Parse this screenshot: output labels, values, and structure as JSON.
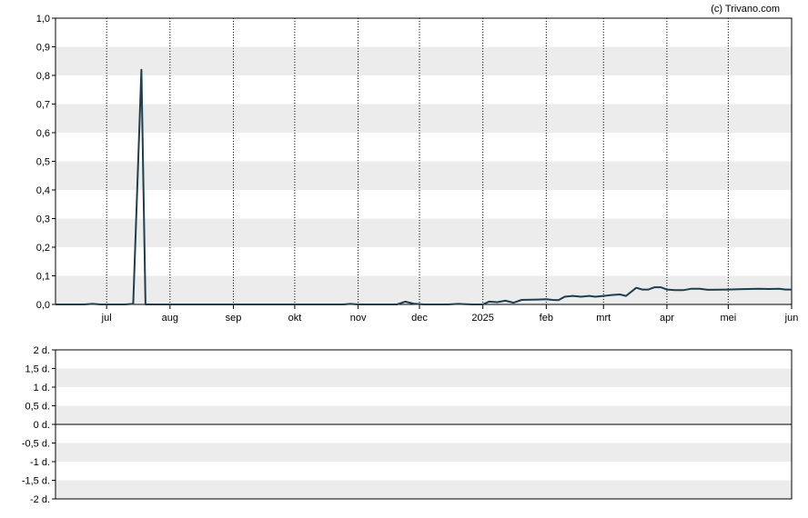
{
  "copyright": "(c) Trivano.com",
  "chart_data": [
    {
      "type": "line",
      "ylim": [
        0,
        1.0
      ],
      "y_ticks": [
        "0,0",
        "0,1",
        "0,2",
        "0,3",
        "0,4",
        "0,5",
        "0,6",
        "0,7",
        "0,8",
        "0,9",
        "1,0"
      ],
      "x_ticks": [
        {
          "label": "jul",
          "date": "2024-07-01"
        },
        {
          "label": "aug",
          "date": "2024-08-01"
        },
        {
          "label": "sep",
          "date": "2024-09-01"
        },
        {
          "label": "okt",
          "date": "2024-10-01"
        },
        {
          "label": "nov",
          "date": "2024-11-01"
        },
        {
          "label": "dec",
          "date": "2024-12-01"
        },
        {
          "label": "2025",
          "date": "2025-01-01"
        },
        {
          "label": "feb",
          "date": "2025-02-01"
        },
        {
          "label": "mrt",
          "date": "2025-03-01"
        },
        {
          "label": "apr",
          "date": "2025-04-01"
        },
        {
          "label": "mei",
          "date": "2025-05-01"
        },
        {
          "label": "jun",
          "date": "2025-06-01"
        }
      ],
      "xlim": [
        "2024-06-06",
        "2025-06-01"
      ],
      "grid": true,
      "line_color": "#1f3e4e",
      "series": [
        {
          "points": [
            [
              "2024-06-06",
              0.0
            ],
            [
              "2024-06-20",
              0.0
            ],
            [
              "2024-06-24",
              0.002
            ],
            [
              "2024-06-28",
              0.0
            ],
            [
              "2024-07-10",
              0.0
            ],
            [
              "2024-07-14",
              0.002
            ],
            [
              "2024-07-18",
              0.82
            ],
            [
              "2024-07-20",
              0.0
            ],
            [
              "2024-08-01",
              0.0
            ],
            [
              "2024-09-01",
              0.0
            ],
            [
              "2024-10-01",
              0.0
            ],
            [
              "2024-10-25",
              0.0
            ],
            [
              "2024-10-28",
              0.002
            ],
            [
              "2024-11-01",
              0.0
            ],
            [
              "2024-11-20",
              0.0
            ],
            [
              "2024-11-24",
              0.01
            ],
            [
              "2024-11-28",
              0.003
            ],
            [
              "2024-12-03",
              0.0
            ],
            [
              "2024-12-15",
              0.0
            ],
            [
              "2024-12-20",
              0.002
            ],
            [
              "2024-12-27",
              0.0
            ],
            [
              "2025-01-01",
              0.0
            ],
            [
              "2025-01-04",
              0.01
            ],
            [
              "2025-01-08",
              0.008
            ],
            [
              "2025-01-12",
              0.013
            ],
            [
              "2025-01-16",
              0.006
            ],
            [
              "2025-01-20",
              0.016
            ],
            [
              "2025-01-28",
              0.017
            ],
            [
              "2025-02-01",
              0.018
            ],
            [
              "2025-02-04",
              0.016
            ],
            [
              "2025-02-07",
              0.015
            ],
            [
              "2025-02-10",
              0.027
            ],
            [
              "2025-02-14",
              0.03
            ],
            [
              "2025-02-18",
              0.027
            ],
            [
              "2025-02-22",
              0.03
            ],
            [
              "2025-02-25",
              0.027
            ],
            [
              "2025-03-01",
              0.03
            ],
            [
              "2025-03-05",
              0.033
            ],
            [
              "2025-03-09",
              0.035
            ],
            [
              "2025-03-12",
              0.03
            ],
            [
              "2025-03-17",
              0.058
            ],
            [
              "2025-03-20",
              0.052
            ],
            [
              "2025-03-23",
              0.052
            ],
            [
              "2025-03-26",
              0.06
            ],
            [
              "2025-03-29",
              0.06
            ],
            [
              "2025-04-01",
              0.052
            ],
            [
              "2025-04-05",
              0.05
            ],
            [
              "2025-04-09",
              0.05
            ],
            [
              "2025-04-13",
              0.055
            ],
            [
              "2025-04-17",
              0.055
            ],
            [
              "2025-04-21",
              0.051
            ],
            [
              "2025-05-01",
              0.052
            ],
            [
              "2025-05-06",
              0.053
            ],
            [
              "2025-05-11",
              0.054
            ],
            [
              "2025-05-16",
              0.055
            ],
            [
              "2025-05-21",
              0.054
            ],
            [
              "2025-05-26",
              0.055
            ],
            [
              "2025-05-29",
              0.052
            ],
            [
              "2025-06-01",
              0.052
            ]
          ]
        }
      ]
    },
    {
      "type": "line",
      "ylim": [
        -2,
        2
      ],
      "y_ticks": [
        "2 d.",
        "1,5 d.",
        "1 d.",
        "0,5 d.",
        "0 d.",
        "-0,5 d.",
        "-1 d.",
        "-1,5 d.",
        "-2 d."
      ],
      "grid": true,
      "zero_line": true,
      "series": []
    }
  ]
}
